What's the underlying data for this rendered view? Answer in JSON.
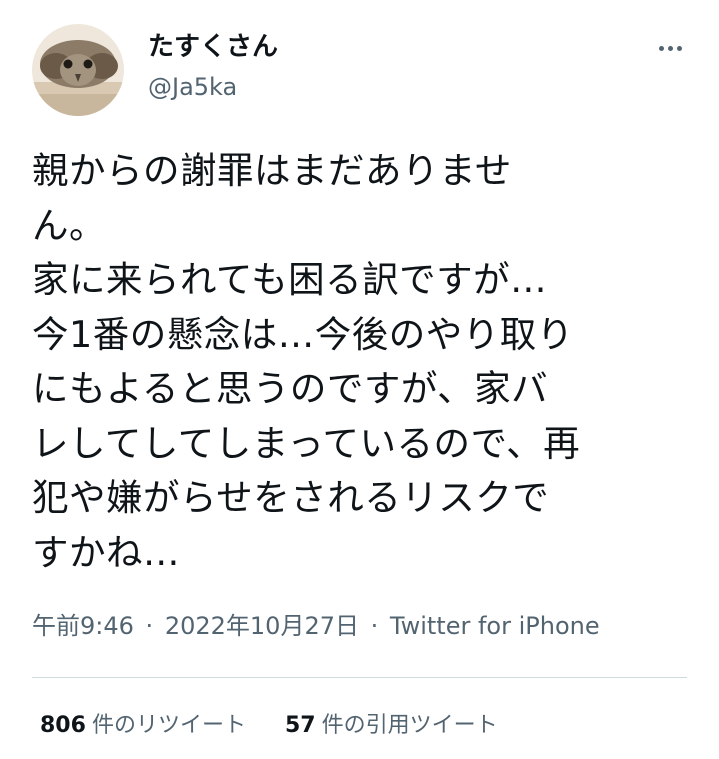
{
  "user": {
    "display_name": "たすくさん",
    "handle": "@Ja5ka",
    "avatar_icon": "avatar-bird-photo"
  },
  "menu": {
    "icon": "more-horizontal-icon"
  },
  "tweet": {
    "lines": [
      "親からの謝罪はまだありませ",
      "ん。",
      "家に来られても困る訳ですが…",
      "今1番の懸念は…今後のやり取り",
      "にもよると思うのですが、家バ",
      "レしてしてしまっているので、再",
      "犯や嫌がらせをされるリスクで",
      "すかね…"
    ]
  },
  "meta": {
    "time": "午前9:46",
    "separator": "·",
    "date": "2022年10月27日",
    "source": "Twitter for iPhone"
  },
  "stats": {
    "retweets_count": "806",
    "retweets_label": "件のリツイート",
    "quotes_count": "57",
    "quotes_label": "件の引用ツイート"
  },
  "colors": {
    "text_primary": "#0f1419",
    "text_secondary": "#536471",
    "divider": "#cfd9de",
    "background": "#ffffff"
  }
}
